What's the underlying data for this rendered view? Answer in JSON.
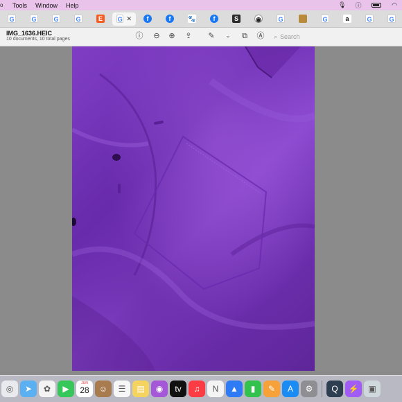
{
  "menubar": {
    "items": [
      "Tools",
      "Window",
      "Help"
    ]
  },
  "tabs": [
    {
      "icon": "google-icon",
      "glyph": "G",
      "style": "g"
    },
    {
      "icon": "google-icon",
      "glyph": "G",
      "style": "g"
    },
    {
      "icon": "google-icon",
      "glyph": "G",
      "style": "g"
    },
    {
      "icon": "google-icon",
      "glyph": "G",
      "style": "g"
    },
    {
      "icon": "etsy-icon",
      "glyph": "E",
      "style": "e"
    },
    {
      "icon": "google-icon",
      "glyph": "G",
      "style": "g"
    },
    {
      "icon": "facebook-icon",
      "glyph": "f",
      "style": "f"
    },
    {
      "icon": "facebook-icon",
      "glyph": "f",
      "style": "f"
    },
    {
      "icon": "paw-icon",
      "glyph": "🐾",
      "style": "paw"
    },
    {
      "icon": "facebook-icon",
      "glyph": "f",
      "style": "f"
    },
    {
      "icon": "s-icon",
      "glyph": "S",
      "style": "s"
    },
    {
      "icon": "github-icon",
      "glyph": "◉",
      "style": "gh"
    },
    {
      "icon": "google-icon",
      "glyph": "G",
      "style": "g"
    },
    {
      "icon": "square-icon",
      "glyph": "",
      "style": "sq"
    },
    {
      "icon": "google-icon",
      "glyph": "G",
      "style": "g"
    },
    {
      "icon": "amazon-icon",
      "glyph": "a",
      "style": "a"
    },
    {
      "icon": "google-icon",
      "glyph": "G",
      "style": "g"
    },
    {
      "icon": "google-icon",
      "glyph": "G",
      "style": "g"
    }
  ],
  "document": {
    "title": "IMG_1636.HEIC",
    "subtitle": "10 documents, 10 total pages"
  },
  "search": {
    "placeholder": "Search"
  },
  "dock": {
    "calendar_day": "JUN",
    "calendar_date": "28",
    "apps": [
      {
        "name": "chrome-icon",
        "glyph": "◎",
        "color": "#e8eaed"
      },
      {
        "name": "maps-icon",
        "glyph": "➤",
        "color": "#5ab0f0"
      },
      {
        "name": "photos-icon",
        "glyph": "✿",
        "color": "#f3f3f3"
      },
      {
        "name": "facetime-icon",
        "glyph": "▶",
        "color": "#35c759"
      },
      {
        "name": "calendar-icon",
        "glyph": "",
        "color": "#ffffff"
      },
      {
        "name": "finder-icon",
        "glyph": "☺",
        "color": "#a97c50"
      },
      {
        "name": "reminders-icon",
        "glyph": "☰",
        "color": "#f7f7f7"
      },
      {
        "name": "notes-icon",
        "glyph": "▤",
        "color": "#f4d35e"
      },
      {
        "name": "podcasts-icon",
        "glyph": "◉",
        "color": "#a458d8"
      },
      {
        "name": "appletv-icon",
        "glyph": "tv",
        "color": "#111111"
      },
      {
        "name": "music-icon",
        "glyph": "♫",
        "color": "#fc3c44"
      },
      {
        "name": "news-icon",
        "glyph": "N",
        "color": "#f4f4f4"
      },
      {
        "name": "keynote-icon",
        "glyph": "▲",
        "color": "#2f7bf5"
      },
      {
        "name": "numbers-icon",
        "glyph": "▮",
        "color": "#33c24d"
      },
      {
        "name": "pages-icon",
        "glyph": "✎",
        "color": "#f7a13a"
      },
      {
        "name": "appstore-icon",
        "glyph": "A",
        "color": "#1c8cf5"
      },
      {
        "name": "settings-icon",
        "glyph": "⚙",
        "color": "#8e8e93"
      }
    ],
    "recent_apps": [
      {
        "name": "quicktime-icon",
        "glyph": "Q",
        "color": "#2c3e50"
      },
      {
        "name": "messenger-icon",
        "glyph": "⚡",
        "color": "#a05cf5"
      },
      {
        "name": "preview-icon",
        "glyph": "▣",
        "color": "#cfd8dc"
      }
    ]
  }
}
